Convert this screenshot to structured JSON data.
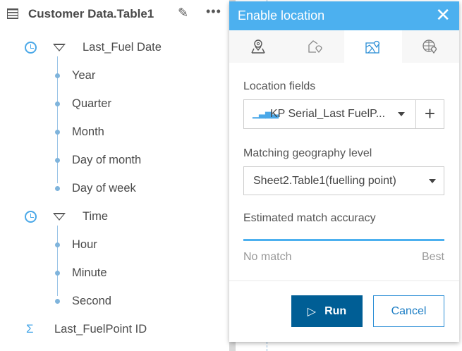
{
  "panel": {
    "title": "Customer Data.Table1",
    "groups": [
      {
        "label": "Last_Fuel Date",
        "children": [
          "Year",
          "Quarter",
          "Month",
          "Day of month",
          "Day of week"
        ]
      },
      {
        "label": "Time",
        "children": [
          "Hour",
          "Minute",
          "Second"
        ]
      }
    ],
    "measure": "Last_FuelPoint ID"
  },
  "dialog": {
    "title": "Enable location",
    "tabs": [
      "address-icon",
      "boundary-icon",
      "geography-icon",
      "coordinates-icon"
    ],
    "selected_tab": 2,
    "location_fields_label": "Location fields",
    "location_field_value": "KP Serial_Last FuelP...",
    "geography_label": "Matching geography level",
    "geography_value": "Sheet2.Table1(fuelling point)",
    "accuracy_label": "Estimated match accuracy",
    "accuracy_min": "No match",
    "accuracy_max": "Best",
    "run": "Run",
    "cancel": "Cancel"
  },
  "colors": {
    "header": "#4cb0ef",
    "run": "#005e95"
  }
}
